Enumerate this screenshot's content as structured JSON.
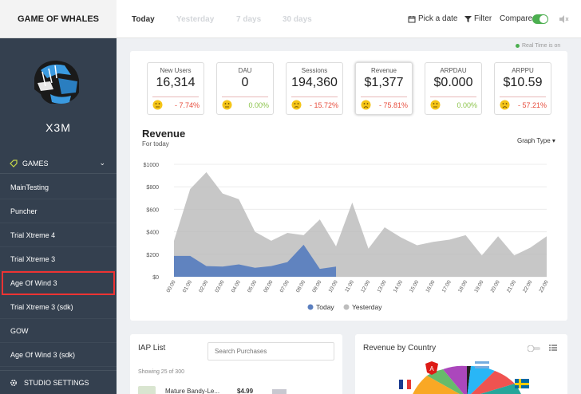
{
  "brand": "GAME OF WHALES",
  "user": {
    "name": "X3M"
  },
  "sidebar": {
    "games_header": "GAMES",
    "items": [
      "MainTesting",
      "Puncher",
      "Trial Xtreme 4",
      "Trial Xtreme 3",
      "Age Of Wind 3",
      "Trial Xtreme 3 (sdk)",
      "GOW",
      "Age Of Wind 3 (sdk)"
    ],
    "selected_index": 4,
    "footer": "STUDIO SETTINGS"
  },
  "topbar": {
    "tabs": [
      "Today",
      "Yesterday",
      "7 days",
      "30 days"
    ],
    "active_tab": "Today",
    "pick_date": "Pick a date",
    "filter": "Filter",
    "compare": "Compare"
  },
  "realtime": "Real Time is on",
  "stats": [
    {
      "label": "New Users",
      "value": "16,314",
      "change": "- 7.74%",
      "mood": "neutral"
    },
    {
      "label": "DAU",
      "value": "0",
      "change": "0.00%",
      "mood": "neutral"
    },
    {
      "label": "Sessions",
      "value": "194,360",
      "change": "- 15.72%",
      "mood": "unhappy"
    },
    {
      "label": "Revenue",
      "value": "$1,377",
      "change": "- 75.81%",
      "mood": "sad"
    },
    {
      "label": "ARPDAU",
      "value": "$0.000",
      "change": "0.00%",
      "mood": "neutral"
    },
    {
      "label": "ARPPU",
      "value": "$10.59",
      "change": "- 57.21%",
      "mood": "sad"
    }
  ],
  "revenue": {
    "title": "Revenue",
    "subtitle": "For today",
    "graph_type": "Graph Type"
  },
  "chart_data": {
    "type": "area",
    "title": "Revenue",
    "x": [
      "00:00",
      "01:00",
      "02:00",
      "03:00",
      "04:00",
      "05:00",
      "06:00",
      "07:00",
      "08:00",
      "09:00",
      "10:00",
      "11:00",
      "12:00",
      "13:00",
      "14:00",
      "15:00",
      "16:00",
      "17:00",
      "18:00",
      "19:00",
      "20:00",
      "21:00",
      "22:00",
      "23:00"
    ],
    "ylim": [
      0,
      1000
    ],
    "yticks": [
      "$0",
      "$200",
      "$400",
      "$600",
      "$800",
      "$1000"
    ],
    "series": [
      {
        "name": "Today",
        "color": "#5b7fbf",
        "values": [
          185,
          185,
          95,
          90,
          110,
          80,
          95,
          130,
          285,
          70,
          90
        ]
      },
      {
        "name": "Yesterday",
        "color": "#bdbdbd",
        "values": [
          320,
          780,
          930,
          740,
          690,
          400,
          320,
          390,
          370,
          510,
          270,
          660,
          250,
          440,
          350,
          280,
          310,
          330,
          370,
          190,
          360,
          190,
          260,
          360
        ]
      }
    ],
    "legend": "bottom"
  },
  "iap": {
    "title": "IAP List",
    "search_placeholder": "Search Purchases",
    "showing": "Showing 25 of 300",
    "first_row": {
      "name": "Mature Bandy-Le...",
      "price": "$4.99"
    }
  },
  "country": {
    "title": "Revenue by Country"
  }
}
